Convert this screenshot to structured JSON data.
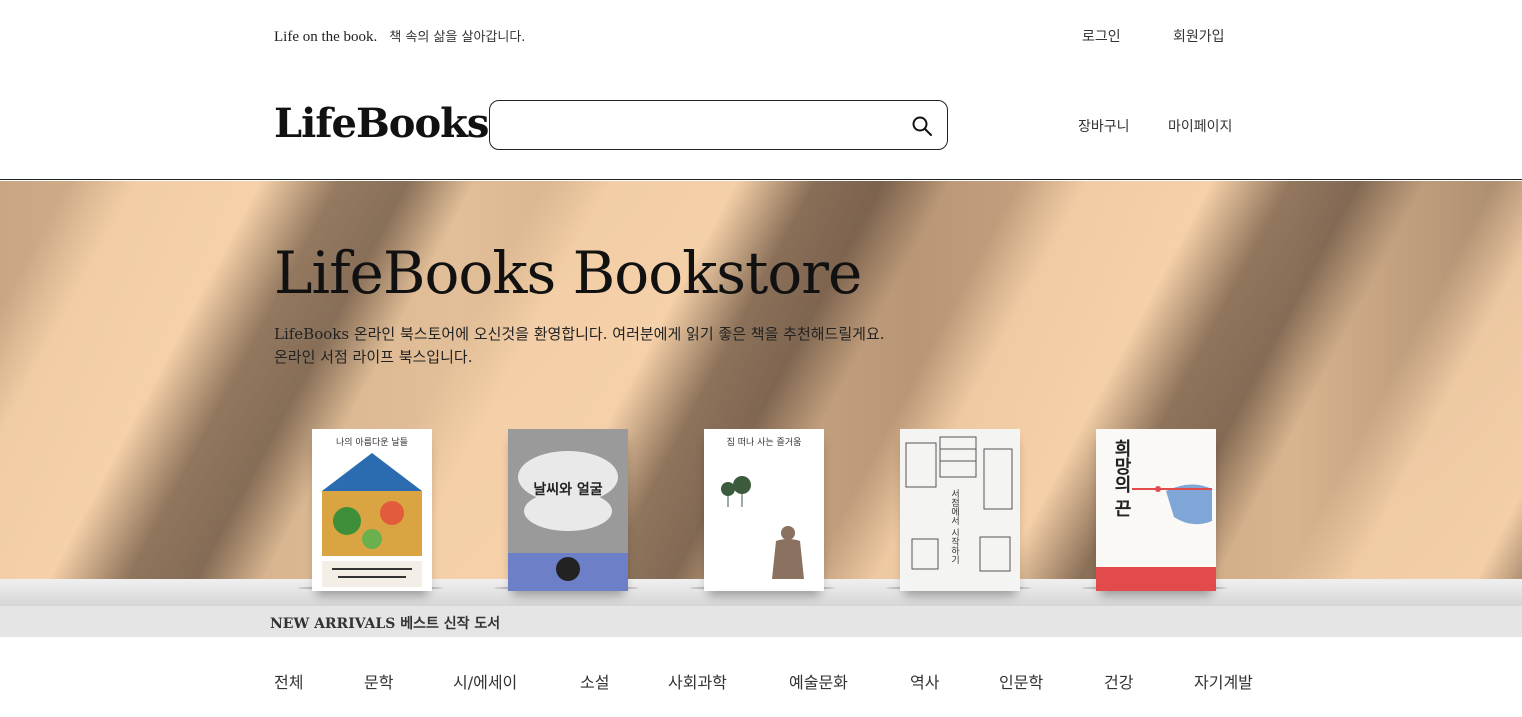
{
  "topbar": {
    "tagline_en": "Life on the book.",
    "tagline_ko": "책 속의 삶을 살아갑니다.",
    "login": "로그인",
    "signup": "회원가입"
  },
  "header": {
    "logo": "LifeBooks",
    "search_placeholder": "",
    "cart": "장바구니",
    "mypage": "마이페이지"
  },
  "hero": {
    "title": "LifeBooks Bookstore",
    "desc_line1": "LifeBooks 온라인 북스토어에 오신것을 환영합니다. 여러분에게 읽기 좋은 책을 추천해드릴게요.",
    "desc_line2": "온라인 서점 라이프 북스입니다."
  },
  "books": [
    {
      "title": "나의 아름다운 날들",
      "cover_color": "#f3efe6",
      "accent": "#2b6cb0"
    },
    {
      "title": "날씨와 얼굴",
      "cover_color": "#8a8a8a",
      "accent": "#6d7fc7"
    },
    {
      "title": "집 떠나 사는 즐거움",
      "cover_color": "#f7f5f0",
      "accent": "#3c5a3c"
    },
    {
      "title": "서점에서 시작하기",
      "cover_color": "#f4f4f2",
      "accent": "#555555"
    },
    {
      "title": "희망의 끈",
      "cover_color": "#faf9f6",
      "accent": "#e24b4b"
    }
  ],
  "shelf": {
    "label": "NEW ARRIVALS 베스트 신작 도서"
  },
  "categories": [
    "전체",
    "문학",
    "시/에세이",
    "소설",
    "사회과학",
    "예술문화",
    "역사",
    "인문학",
    "건강",
    "자기계발"
  ]
}
